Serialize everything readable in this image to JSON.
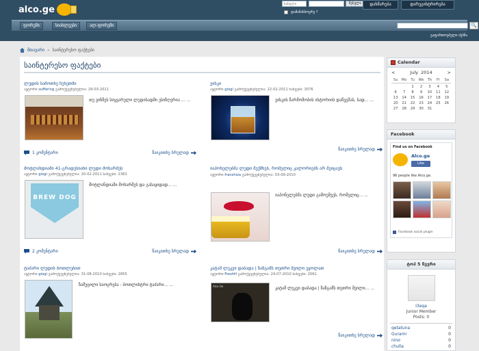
{
  "header": {
    "logo_text": "alco.ge",
    "login_user_placeholder": "სახელი",
    "login_button": "შესვლა",
    "remember_me": "დამიმახსოვრე ?",
    "help_button": "დახმარება",
    "register_button": "დარეგისტრირება",
    "nav_tabs": [
      "ფორუმი",
      "სიახლეები",
      "ალ-ფორუმი"
    ],
    "advanced_search": "გაფართოებული ძებნა",
    "search_icon_glyph": "🔍"
  },
  "breadcrumb": {
    "home": "მთავარი",
    "current": "საინტერესო ფაქტები"
  },
  "main": {
    "page_title": "საინტერესო ფაქტები",
    "read_more": "წაიკითხე სრულად",
    "articles": [
      {
        "title": "ლუდის სამოთხე ჩეხეთში",
        "author": "suffering",
        "meta_prefix": "ავტორი",
        "meta_pub": "გამოქვეყნებულია: 29-03-2011",
        "excerpt": "თუ ვინმეს სიყვარული ლუდისადმი ესიზღვრია ... ...",
        "comments": "1 კომენტარი",
        "thumb": "bar-taps"
      },
      {
        "title": "ვისკი",
        "author": "giogi",
        "meta_prefix": "ავტორი",
        "meta_pub": "გამოქვეყნებულია: 22-02-2011 ნახვები: 3076",
        "excerpt": "ვისკის წარმოშობის ისტორიის დაწვეშას, სად... ...",
        "comments": "",
        "thumb": "whisky-glass"
      },
      {
        "title": "შოტლანდიაში 41-გრადუსიანი ლუდი მოხარშეს",
        "author": "giogi",
        "meta_prefix": "ავტორი",
        "meta_pub": "გამოქვეყნებულია: 20-02-2011 ნახვები: 2363",
        "excerpt": "შოტლანდიაში მოხარშეს და გასაყიდად... ...",
        "comments": "2 კომენტარი",
        "thumb": "brewdog-logo",
        "thumb_text": "BREW DOG"
      },
      {
        "title": "იაპონელებმა ლუდი შექმნეს, რომელიც კალორიებს არ შეიცავს",
        "author": "franshiza",
        "meta_prefix": "ავტორი",
        "meta_pub": "გამოქვეყნებულია: 03-09-2010",
        "excerpt": "იაპონელებმა ლუდი გამოუშვეს, რომელიც... ...",
        "comments": "",
        "thumb": "lips-beer"
      },
      {
        "title": "ტაძარი ლუდის ბოთლებით",
        "author": "giogi",
        "meta_prefix": "ავტორი",
        "meta_pub": "გამოქვეყნებულია: 31-08-2010 ნახვები: 2855",
        "excerpt": "ზამუცილი საოცრება - ბოთლისტრი ტაძარი... ...",
        "comments": "",
        "thumb": "bottle-temple"
      },
      {
        "title": "კატამ ლეკვი დაბადა | ზაზგამს თეთრი შვილი ეყოლათ",
        "author": "FreshH",
        "meta_prefix": "ავტორი",
        "meta_pub": "გამოქვეყნებულია: 24-07-2010 ნახვები: 2061",
        "excerpt": "კატამ ლეკვი დაბადა | ზაზგამს თეთრი შვილი... ...",
        "comments": "",
        "thumb": "black-puppy",
        "thumb_text": "Alco Ge"
      }
    ]
  },
  "sidebar": {
    "calendar": {
      "title": "Calendar",
      "month": "July",
      "year": "2014",
      "prev": "<",
      "next": ">",
      "day_headers": [
        "Su",
        "Mo",
        "Tu",
        "We",
        "Th",
        "Fr",
        "Sa"
      ],
      "days": [
        "",
        "",
        "1",
        "2",
        "3",
        "4",
        "5",
        "6",
        "7",
        "8",
        "9",
        "10",
        "11",
        "12",
        "13",
        "14",
        "15",
        "16",
        "17",
        "18",
        "19",
        "20",
        "21",
        "22",
        "23",
        "24",
        "25",
        "26",
        "27",
        "28",
        "29",
        "30",
        "31",
        "",
        ""
      ]
    },
    "facebook": {
      "title": "Facebook",
      "find_us": "Find us on Facebook",
      "page_name": "Alco.ge",
      "like": "Like",
      "count": "96 people like Alco.ge.",
      "plugin": "Facebook social plugin"
    },
    "top_posters": {
      "title": "ტოპ 5 წევრი",
      "featured_name": "I3eqa",
      "featured_role": "Junior Member",
      "featured_posts": "Posts: 0",
      "rows": [
        {
          "name": "qetatuna",
          "posts": "0"
        },
        {
          "name": "Gurami",
          "posts": "0"
        },
        {
          "name": "nino",
          "posts": "0"
        },
        {
          "name": "chulla",
          "posts": "0"
        }
      ]
    }
  }
}
